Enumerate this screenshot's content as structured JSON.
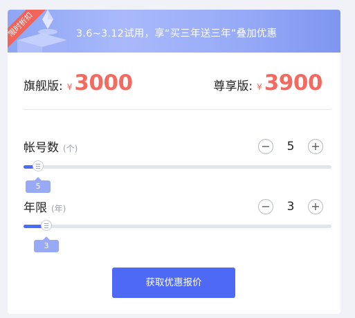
{
  "banner": {
    "ribbon_text": "限时折扣",
    "promo_text": "3.6~3.12试用，享“买三年送三年”叠加优惠"
  },
  "prices": {
    "flagship": {
      "label": "旗舰版:",
      "currency": "¥",
      "value": "3000"
    },
    "premium": {
      "label": "尊享版:",
      "currency": "¥",
      "value": "3900"
    }
  },
  "accounts": {
    "label": "帐号数",
    "unit": "(个)",
    "value": "5",
    "tooltip": "5",
    "minus_symbol": "−",
    "plus_symbol": "+",
    "slider_fraction": 0.02
  },
  "years": {
    "label": "年限",
    "unit": "(年)",
    "value": "3",
    "tooltip": "3",
    "minus_symbol": "−",
    "plus_symbol": "+",
    "slider_fraction": 0.047
  },
  "cta": {
    "label": "获取优惠报价"
  },
  "colors": {
    "accent": "#4e69f6",
    "price": "#f36b60",
    "ribbon": "#f0645a",
    "tooltip": "#98a9f6"
  }
}
